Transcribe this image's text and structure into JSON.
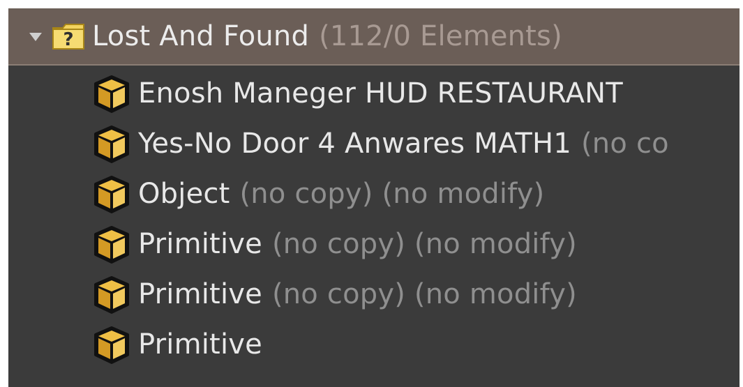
{
  "folder": {
    "name": "Lost And Found",
    "count": "(112/0 Elements)",
    "icon": "lost-and-found-folder-icon"
  },
  "items": [
    {
      "name": "Enosh Maneger HUD RESTAURANT",
      "meta": "",
      "icon": "object-box-icon"
    },
    {
      "name": "Yes-No Door 4 Anwares MATH1",
      "meta": "(no co",
      "icon": "object-box-icon"
    },
    {
      "name": "Object",
      "meta": "(no copy) (no modify)",
      "icon": "object-box-icon"
    },
    {
      "name": "Primitive",
      "meta": "(no copy) (no modify)",
      "icon": "object-box-icon"
    },
    {
      "name": "Primitive",
      "meta": "(no copy) (no modify)",
      "icon": "object-box-icon"
    },
    {
      "name": "Primitive",
      "meta": "",
      "icon": "object-box-icon"
    }
  ],
  "colors": {
    "panel_bg": "#3b3b3b",
    "selected_row": "#6b5e57",
    "text": "#e8e8e8",
    "muted_text": "#8f8f8f",
    "icon_gold": "#d8a531"
  }
}
